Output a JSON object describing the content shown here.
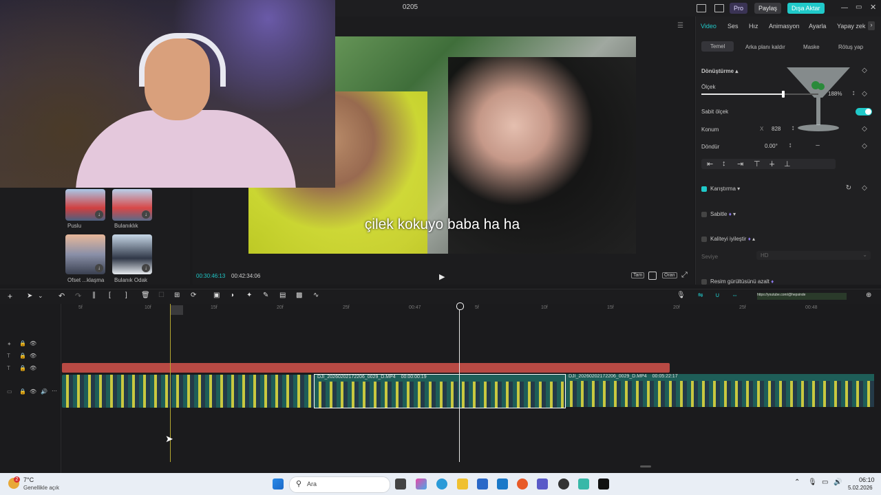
{
  "window": {
    "title": "0205",
    "pro_label": "Pro",
    "share_label": "Paylaş",
    "export_label": "Dışa Aktar"
  },
  "player": {
    "subtitle": "çilek kokuyo baba ha ha",
    "current_time": "00:30:46:13",
    "total_time": "00:42:34:06",
    "full_label": "Tam",
    "ratio_label": "Oran"
  },
  "right_panel": {
    "tabs": [
      "Video",
      "Ses",
      "Hız",
      "Animasyon",
      "Ayarla",
      "Yapay zek"
    ],
    "subtabs": [
      "Temel",
      "Arka planı kaldır",
      "Maske",
      "Rötuş yap"
    ],
    "transform_label": "Dönüştürme",
    "scale_label": "Ölçek",
    "scale_value": "188%",
    "scale_fraction": 0.7,
    "uniform_scale_label": "Sabit ölçek",
    "uniform_scale_on": true,
    "position_label": "Konum",
    "position_x_label": "X",
    "position_x": "828",
    "rotate_label": "Döndür",
    "rotate_value": "0.00°",
    "blend_label": "Karıştırma",
    "stabilize_label": "Sabitle",
    "enhance_label": "Kaliteyi iyileştir",
    "enhance_sub_label": "Seviye",
    "enhance_quality": "HD",
    "denoise_label": "Resim gürültüsünü azalt",
    "accent_color": "#20c9c9"
  },
  "media": {
    "items": [
      {
        "label": "Puslu"
      },
      {
        "label": "Bulanıklık"
      },
      {
        "label": "Ofset ...klaşma"
      },
      {
        "label": "Bulanık Odak"
      }
    ]
  },
  "timeline": {
    "ruler": [
      "5f",
      "10f",
      "15f",
      "20f",
      "25f",
      "00:47",
      "5f",
      "10f",
      "15f",
      "20f",
      "25f",
      "00:48"
    ],
    "clips": [
      {
        "name": "DJI_20260202172206_0029_D.MP4",
        "duration": "00:00:00:19"
      },
      {
        "name": "DJI_20260202172206_0029_D.MP4",
        "duration": "00:05:22:17"
      }
    ],
    "url_text": "https://youtube.com/@hepsinde"
  },
  "taskbar": {
    "temperature": "7°C",
    "weather": "Genellikle açık",
    "search_placeholder": "Ara",
    "time": "06:10",
    "date": "5.02.2026",
    "badge": "2"
  }
}
